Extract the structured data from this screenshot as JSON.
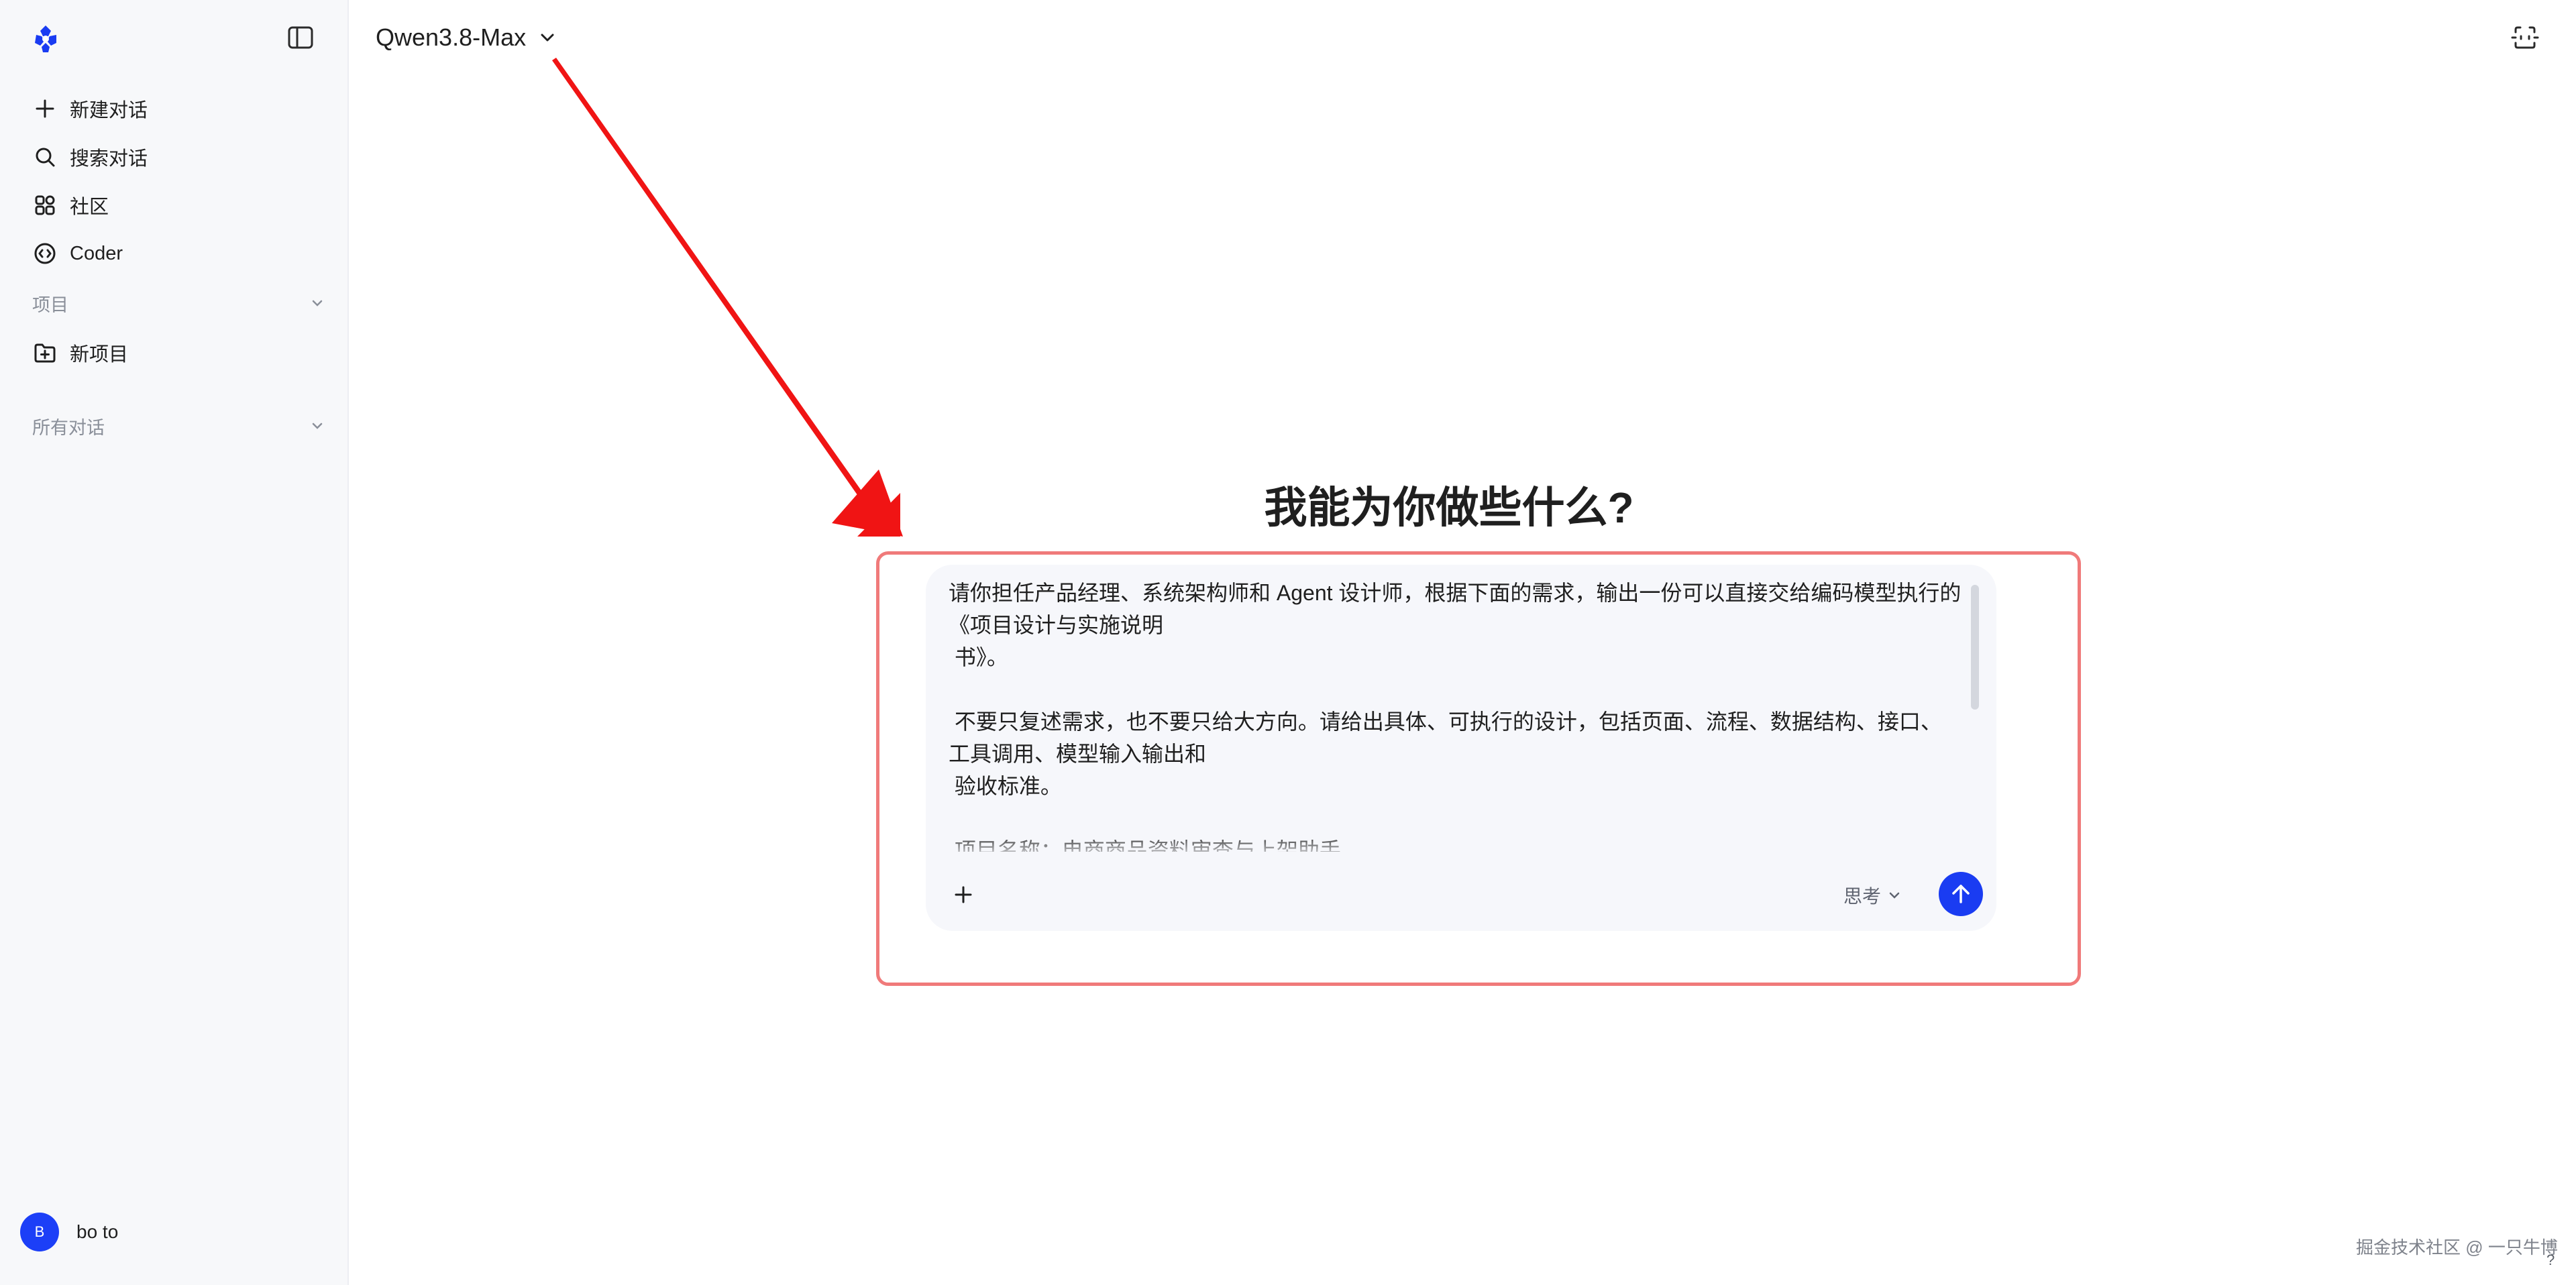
{
  "header": {
    "model_name": "Qwen3.8-Max"
  },
  "sidebar": {
    "items": [
      {
        "label": "新建对话",
        "icon": "plus-icon"
      },
      {
        "label": "搜索对话",
        "icon": "search-icon"
      },
      {
        "label": "社区",
        "icon": "grid-icon"
      },
      {
        "label": "Coder",
        "icon": "code-icon"
      }
    ],
    "projects_label": "项目",
    "new_project_label": "新项目",
    "all_chats_label": "所有对话",
    "user": {
      "initial": "B",
      "name": "bo to"
    }
  },
  "main": {
    "greeting": "我能为你做些什么?",
    "prompt_text": "请你担任产品经理、系统架构师和 Agent 设计师，根据下面的需求，输出一份可以直接交给编码模型执行的《项目设计与实施说明\n 书》。\n\n 不要只复述需求，也不要只给大方向。请给出具体、可执行的设计，包括页面、流程、数据结构、接口、工具调用、模型输入输出和\n 验收标准。\n\n 项目名称：电商商品资料审查与上架助手",
    "think_label": "思考"
  },
  "colors": {
    "accent": "#1a3cf2",
    "highlight": "#f07a7a",
    "annotation_arrow": "#f01414",
    "sidebar_bg": "#f7f8fa"
  },
  "watermark": "掘金技术社区 @ 一只牛博",
  "help_label": "?"
}
